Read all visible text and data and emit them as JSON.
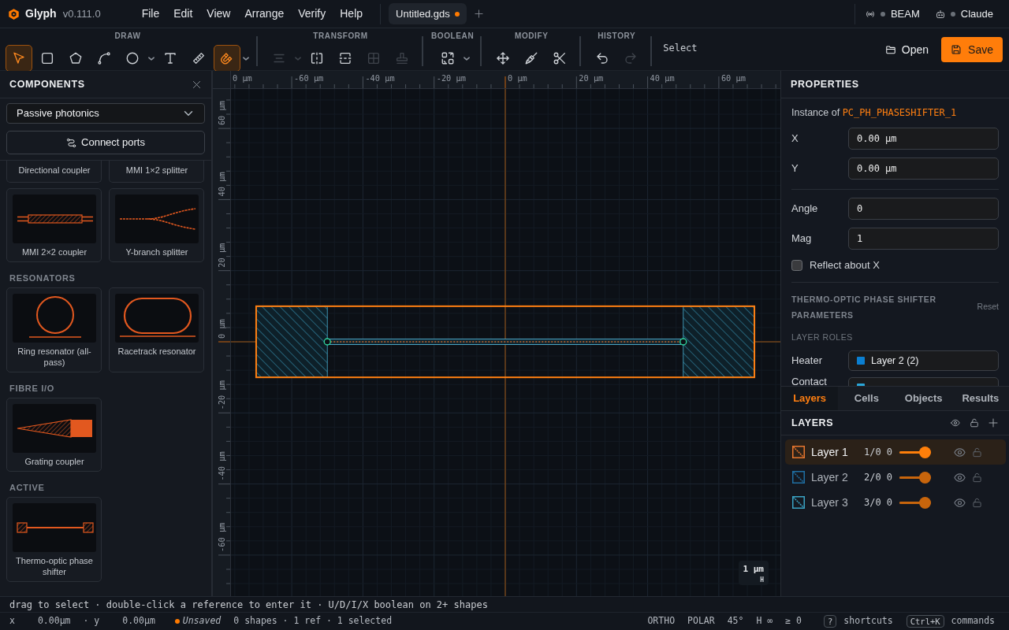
{
  "app": {
    "name": "Glyph",
    "version": "v0.111.0"
  },
  "menu": [
    "File",
    "Edit",
    "View",
    "Arrange",
    "Verify",
    "Help"
  ],
  "document_tabs": [
    {
      "label": "Untitled.gds",
      "selected": true,
      "unsaved": true
    }
  ],
  "services": [
    {
      "kind": "signal",
      "label": "BEAM",
      "connected": false
    },
    {
      "kind": "bot",
      "label": "Claude",
      "connected": false
    }
  ],
  "toolbar": {
    "groups": [
      {
        "title": "DRAW",
        "tools": [
          {
            "kind": "select",
            "active": true,
            "disabled": false,
            "menu": false
          },
          {
            "kind": "rectangle",
            "active": false,
            "disabled": false,
            "menu": false
          },
          {
            "kind": "polygon",
            "active": false,
            "disabled": false,
            "menu": false
          },
          {
            "kind": "path",
            "active": false,
            "disabled": false,
            "menu": false
          },
          {
            "kind": "circle",
            "active": false,
            "disabled": false,
            "menu": true
          },
          {
            "kind": "text",
            "active": false,
            "disabled": false,
            "menu": false
          },
          {
            "kind": "ruler",
            "active": false,
            "disabled": false,
            "menu": false
          },
          {
            "kind": "magnet",
            "active": true,
            "disabled": false,
            "menu": true
          }
        ]
      },
      {
        "title": "TRANSFORM",
        "tools": [
          {
            "kind": "align",
            "active": false,
            "disabled": true,
            "menu": true
          },
          {
            "kind": "fliph",
            "active": false,
            "disabled": false,
            "menu": false
          },
          {
            "kind": "flipv",
            "active": false,
            "disabled": false,
            "menu": false
          },
          {
            "kind": "grid",
            "active": false,
            "disabled": true,
            "menu": false
          },
          {
            "kind": "stamp",
            "active": false,
            "disabled": true,
            "menu": false
          }
        ]
      },
      {
        "title": "BOOLEAN",
        "tools": [
          {
            "kind": "boolean",
            "active": false,
            "disabled": false,
            "menu": true
          }
        ]
      },
      {
        "title": "MODIFY",
        "tools": [
          {
            "kind": "move",
            "active": false,
            "disabled": false,
            "menu": false
          },
          {
            "kind": "brush",
            "active": false,
            "disabled": false,
            "menu": false
          },
          {
            "kind": "scissors",
            "active": false,
            "disabled": false,
            "menu": false
          }
        ]
      },
      {
        "title": "HISTORY",
        "tools": [
          {
            "kind": "undo",
            "active": false,
            "disabled": false,
            "menu": false
          },
          {
            "kind": "redo",
            "active": false,
            "disabled": true,
            "menu": false
          }
        ]
      }
    ],
    "mode": "Select",
    "actions": [
      {
        "kind": "open",
        "label": "Open",
        "primary": false
      },
      {
        "kind": "save",
        "label": "Save",
        "primary": true
      }
    ]
  },
  "components": {
    "title": "COMPONENTS",
    "library": "Passive photonics",
    "connect_label": "Connect ports",
    "groups": [
      {
        "items": [
          {
            "label": "Directional coupler"
          },
          {
            "label": "MMI 1×2 splitter"
          },
          {
            "label": "MMI 2×2 coupler",
            "kind": "mmi"
          },
          {
            "label": "Y-branch splitter",
            "kind": "ybranch"
          }
        ]
      },
      {
        "title": "RESONATORS",
        "items": [
          {
            "label": "Ring resonator (all-pass)",
            "kind": "ring"
          },
          {
            "label": "Racetrack resonator",
            "kind": "racetrack"
          }
        ]
      },
      {
        "title": "FIBRE I/O",
        "items": [
          {
            "label": "Grating coupler",
            "kind": "grating"
          }
        ]
      },
      {
        "title": "ACTIVE",
        "items": [
          {
            "label": "Thermo-optic phase shifter",
            "kind": "heater"
          }
        ]
      }
    ]
  },
  "canvas": {
    "x_ruler": [
      "0 µm",
      "-60 µm",
      "-40 µm",
      "-20 µm",
      "0 µm",
      "20 µm",
      "40 µm",
      "60 µm"
    ],
    "y_ruler": [
      "60 µm",
      "40 µm",
      "20 µm",
      "0 µm",
      "-20 µm",
      "-40 µm",
      "-60 µm"
    ],
    "scale": "1 µm",
    "scale_mode": "H"
  },
  "properties": {
    "title": "PROPERTIES",
    "instance_prefix": "Instance of",
    "instance_name": "PC_PH_PHASESHIFTER_1",
    "field_groups": [
      [
        {
          "label": "X",
          "value": "0.00 µm"
        },
        {
          "label": "Y",
          "value": "0.00 µm"
        }
      ],
      [
        {
          "label": "Angle",
          "value": "0"
        },
        {
          "label": "Mag",
          "value": "1"
        }
      ]
    ],
    "reflect": {
      "label": "Reflect about X",
      "checked": false
    },
    "parameters_title": "THERMO-OPTIC PHASE SHIFTER PARAMETERS",
    "reset_label": "Reset",
    "roles_title": "LAYER ROLES",
    "roles": [
      {
        "label": "Heater",
        "value": "Layer 2 (2)",
        "color": "#0b7fd0"
      },
      {
        "label": "Contact",
        "color": "#2aa6d8"
      }
    ]
  },
  "bottom_tabs": [
    {
      "label": "Layers",
      "selected": true
    },
    {
      "label": "Cells",
      "selected": false
    },
    {
      "label": "Objects",
      "selected": false
    },
    {
      "label": "Results",
      "selected": false
    }
  ],
  "layers": {
    "title": "LAYERS",
    "items": [
      {
        "name": "Layer 1",
        "number": "1/0",
        "value": "0",
        "color": "#e8772e",
        "level": 1,
        "selected": true,
        "visible": true,
        "locked": false
      },
      {
        "name": "Layer 2",
        "number": "2/0",
        "value": "0",
        "color": "#1f6fa3",
        "level": 1,
        "selected": false,
        "visible": true,
        "locked": false
      },
      {
        "name": "Layer 3",
        "number": "3/0",
        "value": "0",
        "color": "#3aa3c4",
        "level": 1,
        "selected": false,
        "visible": true,
        "locked": false
      }
    ]
  },
  "hint": "drag to select · double-click a reference to enter it · U/D/I/X boolean on 2+ shapes",
  "status": {
    "x_label": "x",
    "x_value": "0.00µm",
    "y_label": "· y",
    "y_value": "0.00µm",
    "save_label": "Unsaved",
    "unsaved": true,
    "summary": "0 shapes · 1 ref · 1 selected",
    "modes": [
      "ORTHO",
      "POLAR",
      "45°",
      "H ∞",
      "≥ 0"
    ],
    "shortcuts": [
      {
        "key": "?",
        "label": "shortcuts"
      },
      {
        "key": "Ctrl+K",
        "label": "commands"
      }
    ]
  }
}
